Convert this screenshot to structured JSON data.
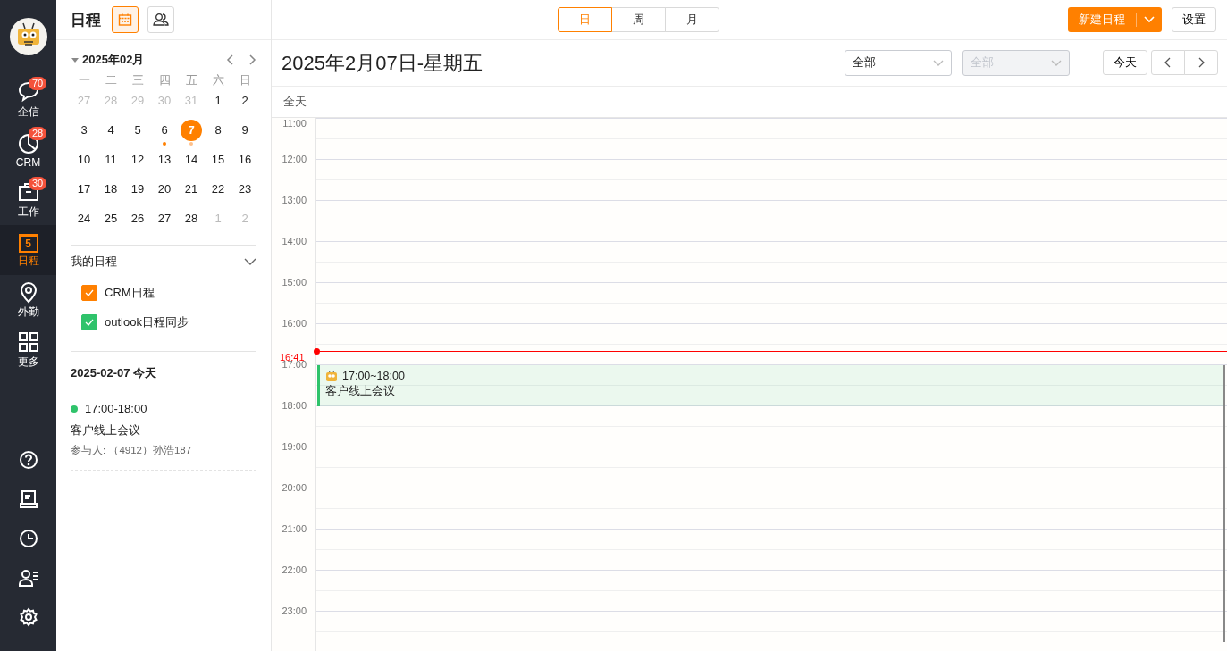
{
  "nav": {
    "items": [
      {
        "kind": "chat",
        "label": "企信",
        "badge": "70",
        "selected": false
      },
      {
        "kind": "crm",
        "label": "CRM",
        "badge": "28",
        "selected": false
      },
      {
        "kind": "work",
        "label": "工作",
        "badge": "30",
        "selected": false
      },
      {
        "kind": "calendar",
        "label": "日程",
        "icon_text": "5",
        "selected": true
      },
      {
        "kind": "location",
        "label": "外勤",
        "selected": false
      },
      {
        "kind": "grid",
        "label": "更多",
        "selected": false
      }
    ],
    "tools": [
      {
        "kind": "help"
      },
      {
        "kind": "notebook"
      },
      {
        "kind": "clock"
      },
      {
        "kind": "contacts"
      },
      {
        "kind": "settings"
      }
    ]
  },
  "header": {
    "title": "日程",
    "modes": [
      {
        "kind": "calendar",
        "selected": true
      },
      {
        "kind": "people",
        "selected": false
      }
    ],
    "view_tabs": [
      {
        "label": "日",
        "selected": true
      },
      {
        "label": "周",
        "selected": false
      },
      {
        "label": "月",
        "selected": false
      }
    ],
    "new_button": "新建日程",
    "settings_button": "设置"
  },
  "mini_calendar": {
    "month": "2025年02月",
    "weekdays": [
      "一",
      "二",
      "三",
      "四",
      "五",
      "六",
      "日"
    ],
    "weeks": [
      [
        {
          "day": "27",
          "muted": true
        },
        {
          "day": "28",
          "muted": true
        },
        {
          "day": "29",
          "muted": true
        },
        {
          "day": "30",
          "muted": true
        },
        {
          "day": "31",
          "muted": true
        },
        {
          "day": "1",
          "muted": false
        },
        {
          "day": "2",
          "muted": false
        }
      ],
      [
        {
          "day": "3",
          "muted": false
        },
        {
          "day": "4",
          "muted": false
        },
        {
          "day": "5",
          "muted": false
        },
        {
          "day": "6",
          "muted": false,
          "dot": true
        },
        {
          "day": "7",
          "muted": false,
          "selected": true,
          "dot": true
        },
        {
          "day": "8",
          "muted": false
        },
        {
          "day": "9",
          "muted": false
        }
      ],
      [
        {
          "day": "10",
          "muted": false
        },
        {
          "day": "11",
          "muted": false
        },
        {
          "day": "12",
          "muted": false
        },
        {
          "day": "13",
          "muted": false
        },
        {
          "day": "14",
          "muted": false
        },
        {
          "day": "15",
          "muted": false
        },
        {
          "day": "16",
          "muted": false
        }
      ],
      [
        {
          "day": "17",
          "muted": false
        },
        {
          "day": "18",
          "muted": false
        },
        {
          "day": "19",
          "muted": false
        },
        {
          "day": "20",
          "muted": false
        },
        {
          "day": "21",
          "muted": false
        },
        {
          "day": "22",
          "muted": false
        },
        {
          "day": "23",
          "muted": false
        }
      ],
      [
        {
          "day": "24",
          "muted": false
        },
        {
          "day": "25",
          "muted": false
        },
        {
          "day": "26",
          "muted": false
        },
        {
          "day": "27",
          "muted": false
        },
        {
          "day": "28",
          "muted": false
        },
        {
          "day": "1",
          "muted": true
        },
        {
          "day": "2",
          "muted": true
        }
      ]
    ]
  },
  "my_calendars": {
    "title": "我的日程",
    "expanded": true,
    "items": [
      {
        "label": "CRM日程",
        "checked": true,
        "color": "#ff8000"
      },
      {
        "label": "outlook日程同步",
        "checked": true,
        "color": "#2fc36b"
      }
    ]
  },
  "agenda": {
    "date": "2025-02-07 今天",
    "events": [
      {
        "time": "17:00-18:00",
        "title": "客户线上会议",
        "participants": "参与人: （4912）孙浩187",
        "color": "#2fc36b"
      }
    ]
  },
  "day_view": {
    "title": "2025年2月07日-星期五",
    "filters": [
      {
        "value": "全部",
        "disabled": false
      },
      {
        "value": "全部",
        "disabled": true
      }
    ],
    "today_button": "今天",
    "all_day": "全天",
    "hours": [
      "11:00",
      "12:00",
      "13:00",
      "14:00",
      "15:00",
      "16:00",
      "17:00",
      "18:00",
      "19:00",
      "20:00",
      "21:00",
      "22:00",
      "23:00"
    ],
    "now": "16:41",
    "events": [
      {
        "time": "17:00~18:00",
        "title": "客户线上会议",
        "color": "#2fc36b"
      }
    ]
  }
}
